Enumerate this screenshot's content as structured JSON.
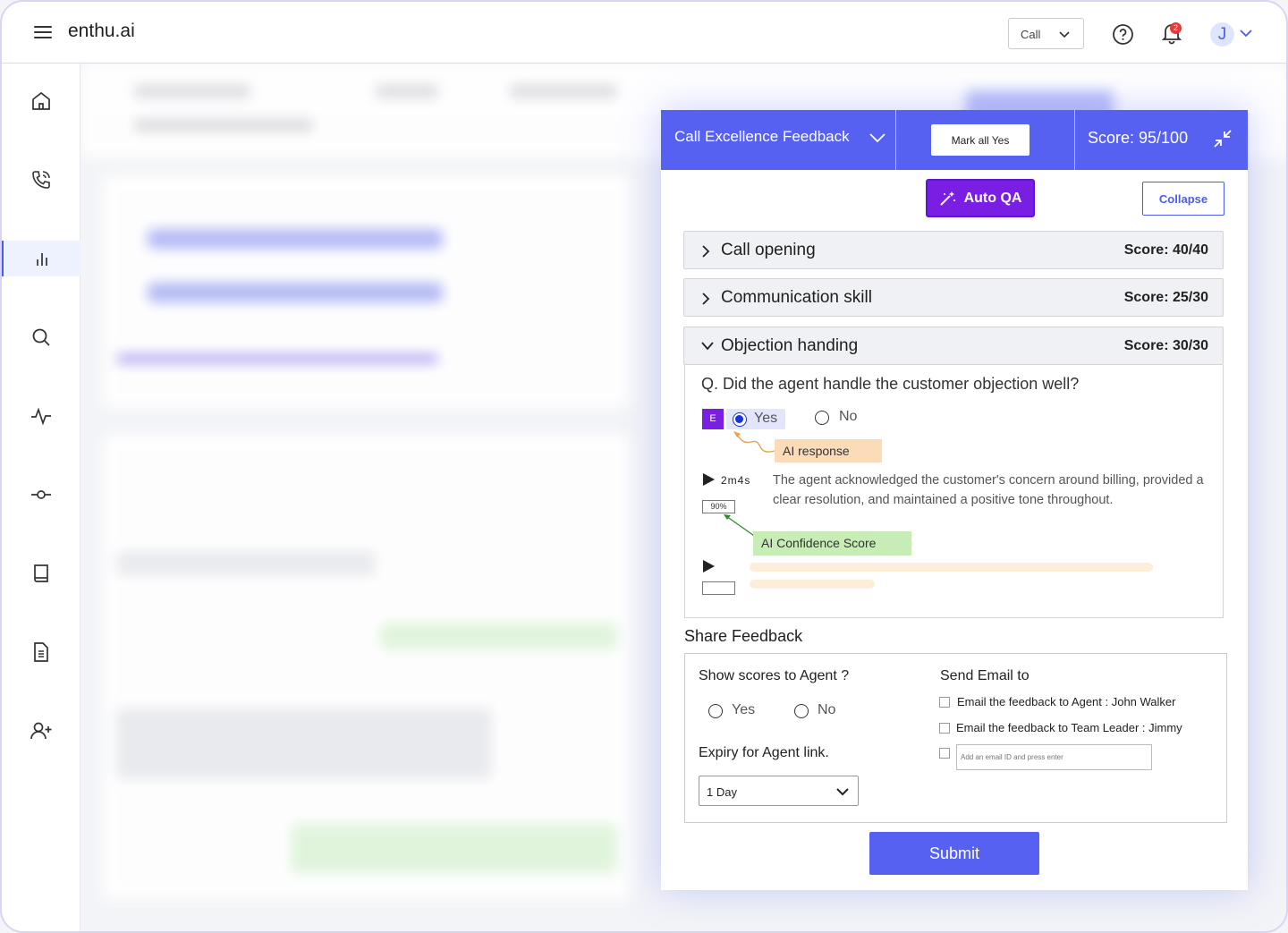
{
  "app": {
    "brand": "enthu.ai"
  },
  "header": {
    "call_select": "Call",
    "notification_count": "2",
    "avatar_initial": "J"
  },
  "sidebar": {
    "items": [
      {
        "icon": "home-icon"
      },
      {
        "icon": "phone-icon"
      },
      {
        "icon": "analytics-icon",
        "active": true
      },
      {
        "icon": "search-icon"
      },
      {
        "icon": "activity-icon"
      },
      {
        "icon": "commit-icon"
      },
      {
        "icon": "book-icon"
      },
      {
        "icon": "document-icon"
      },
      {
        "icon": "add-user-icon"
      }
    ]
  },
  "panel": {
    "title": "Call Excellence Feedback",
    "mark_all": "Mark all Yes",
    "score": "Score: 95/100",
    "auto_qa": "Auto QA",
    "collapse": "Collapse",
    "sections": [
      {
        "title": "Call opening",
        "score": "Score: 40/40"
      },
      {
        "title": "Communication skill",
        "score": "Score: 25/30"
      },
      {
        "title": "Objection handing",
        "score": "Score: 30/30"
      }
    ],
    "question": {
      "text": "Q. Did the agent handle the customer objection well?",
      "badge": "E",
      "yes": "Yes",
      "no": "No",
      "ai_response_tag": "AI response",
      "timecode": "2m4s",
      "ai_text": "The agent acknowledged the customer's concern around billing, provided a clear resolution, and maintained a positive tone throughout.",
      "confidence": "90%",
      "confidence_tag": "AI Confidence Score"
    },
    "share": {
      "title": "Share Feedback",
      "show_scores": "Show scores to Agent ?",
      "yes": "Yes",
      "no": "No",
      "expiry_label": "Expiry for Agent link.",
      "expiry_value": "1 Day",
      "send_email": "Send Email to",
      "email_agent": "Email the feedback to Agent : John Walker",
      "email_lead": "Email the feedback to Team Leader : Jimmy",
      "email_placeholder": "Add an email ID and press enter"
    },
    "submit": "Submit"
  },
  "colors": {
    "accent": "#5661f1",
    "purple": "#7b1ee3",
    "orange_tag": "#fcdcb8",
    "green_tag": "#c7ecb6"
  }
}
